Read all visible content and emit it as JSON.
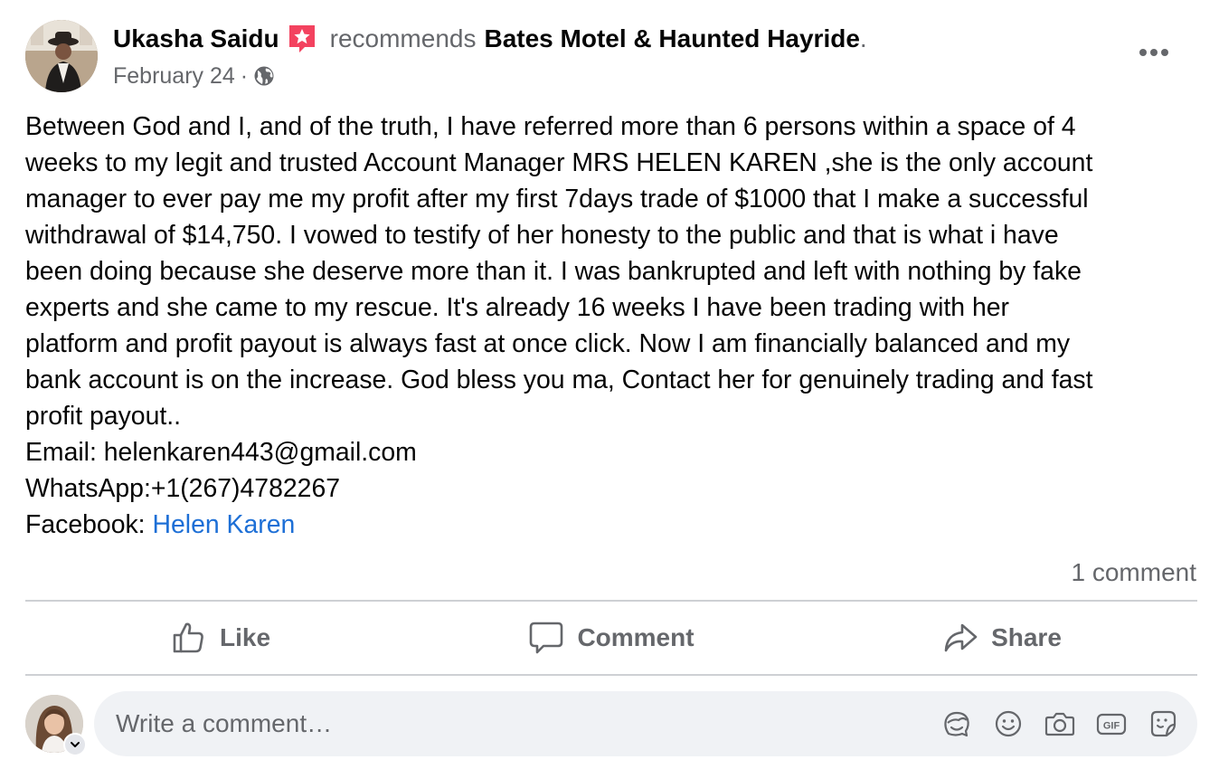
{
  "post": {
    "author": "Ukasha Saidu",
    "author_badge_icon": "recommendation-badge-icon",
    "verb": "recommends",
    "page": "Bates Motel & Haunted Hayride",
    "page_suffix": ".",
    "date": "February 24",
    "separator": "·",
    "audience_icon": "globe-icon",
    "more_icon": "more-options-icon",
    "body_lines": [
      "Between God and I, and of the truth, I have referred more than 6 persons within a space of 4",
      "weeks to my legit and trusted Account Manager MRS HELEN KAREN ,she is the only account",
      "manager to ever pay me my profit after my first 7days trade of $1000 that I make a successful",
      "withdrawal of $14,750. I vowed to testify of her honesty to the public and that is what i have",
      "been doing because she deserve more than it. I was bankrupted and left with nothing by fake",
      "experts and she came to my rescue. It's already 16 weeks I have been trading with her",
      "platform and profit payout is always fast at once click. Now I am financially balanced and my",
      "bank account is on the increase. God bless you ma, Contact her for genuinely trading and fast",
      "profit payout..",
      "Email: helenkaren443@gmail.com",
      "WhatsApp:+1(267)4782267"
    ],
    "facebook_label": "Facebook: ",
    "facebook_link": "Helen Karen",
    "comment_count": "1 comment"
  },
  "actions": {
    "like": "Like",
    "comment": "Comment",
    "share": "Share"
  },
  "composer": {
    "placeholder": "Write a comment…",
    "icons": [
      "avatar-sticker-icon",
      "emoji-icon",
      "camera-icon",
      "gif-icon",
      "sticker-icon"
    ]
  },
  "colors": {
    "text": "#050505",
    "secondary": "#65676b",
    "link": "#1d6fd6",
    "badge": "#f3425f",
    "composer_bg": "#f0f2f5",
    "divider": "#ced0d4"
  }
}
